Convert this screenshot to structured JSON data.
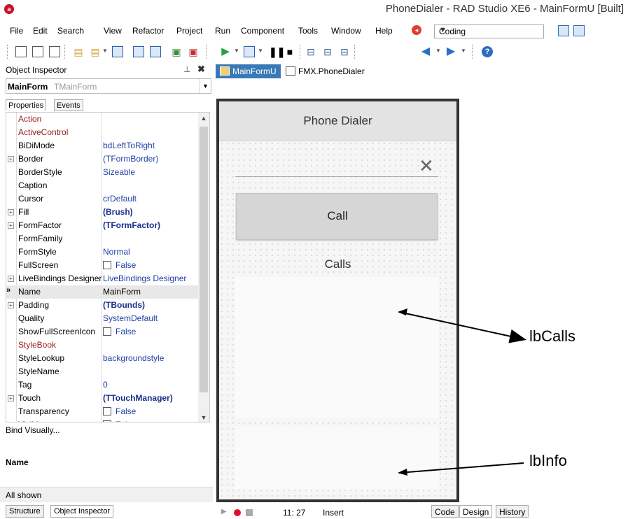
{
  "window": {
    "title": "PhoneDialer - RAD Studio XE6 - MainFormU [Built]",
    "logo_letter": "a"
  },
  "menu": [
    "File",
    "Edit",
    "Search",
    "View",
    "Refactor",
    "Project",
    "Run",
    "Component",
    "Tools",
    "Window",
    "Help"
  ],
  "desktop_layout": {
    "value": "Coding"
  },
  "toolbar": {
    "icons": [
      "new-file-icon",
      "new-form-icon",
      "open-icon",
      "open-project-icon",
      "reopen-icon",
      "save-icon",
      "save-all-icon",
      "open-file-icon",
      "add-file-icon",
      "remove-file-icon",
      "run-icon",
      "run-without-debug-icon",
      "pause-icon",
      "stop-icon",
      "trace-into-icon",
      "step-over-icon",
      "run-to-cursor-icon",
      "back-icon",
      "forward-icon",
      "help-icon"
    ],
    "help_glyph": "?"
  },
  "object_inspector": {
    "title": "Object Inspector",
    "pin_glyph": "⊥",
    "close_glyph": "✖",
    "selected_object": {
      "name": "MainForm",
      "type": "TMainForm"
    },
    "tabs": [
      "Properties",
      "Events"
    ],
    "properties": [
      {
        "name": "Action",
        "value": "",
        "style": "red"
      },
      {
        "name": "ActiveControl",
        "value": "",
        "style": "red"
      },
      {
        "name": "BiDiMode",
        "value": "bdLeftToRight"
      },
      {
        "name": "Border",
        "value": "(TFormBorder)",
        "expandable": true
      },
      {
        "name": "BorderStyle",
        "value": "Sizeable"
      },
      {
        "name": "Caption",
        "value": ""
      },
      {
        "name": "Cursor",
        "value": "crDefault"
      },
      {
        "name": "Fill",
        "value": "(Brush)",
        "expandable": true,
        "bold": true
      },
      {
        "name": "FormFactor",
        "value": "(TFormFactor)",
        "expandable": true,
        "bold": true
      },
      {
        "name": "FormFamily",
        "value": ""
      },
      {
        "name": "FormStyle",
        "value": "Normal"
      },
      {
        "name": "FullScreen",
        "value": "False",
        "checkbox": true
      },
      {
        "name": "LiveBindings Designer",
        "value": "LiveBindings Designer",
        "expandable": true
      },
      {
        "name": "Name",
        "value": "MainForm",
        "selected": true
      },
      {
        "name": "Padding",
        "value": "(TBounds)",
        "expandable": true,
        "bold": true
      },
      {
        "name": "Quality",
        "value": "SystemDefault"
      },
      {
        "name": "ShowFullScreenIcon",
        "value": "False",
        "checkbox": true
      },
      {
        "name": "StyleBook",
        "value": "",
        "style": "red"
      },
      {
        "name": "StyleLookup",
        "value": "backgroundstyle"
      },
      {
        "name": "StyleName",
        "value": ""
      },
      {
        "name": "Tag",
        "value": "0"
      },
      {
        "name": "Touch",
        "value": "(TTouchManager)",
        "expandable": true,
        "bold": true
      },
      {
        "name": "Transparency",
        "value": "False",
        "checkbox": true
      },
      {
        "name": "Visible",
        "value": "False",
        "checkbox": true
      }
    ],
    "bind_visually": "Bind Visually...",
    "description_name": "Name",
    "filter_text": "All shown",
    "bottom_tabs": [
      "Structure",
      "Object Inspector"
    ]
  },
  "editor_tabs": [
    {
      "label": "MainFormU",
      "active": true
    },
    {
      "label": "FMX.PhoneDialer",
      "active": false
    }
  ],
  "form": {
    "header": "Phone Dialer",
    "clear_glyph": "✕",
    "call_button": "Call",
    "calls_label": "Calls"
  },
  "callouts": {
    "calls_list": "lbCalls",
    "info_list": "lbInfo"
  },
  "status": {
    "position": "11: 27",
    "mode": "Insert"
  },
  "view_tabs": [
    "Code",
    "Design",
    "History"
  ]
}
